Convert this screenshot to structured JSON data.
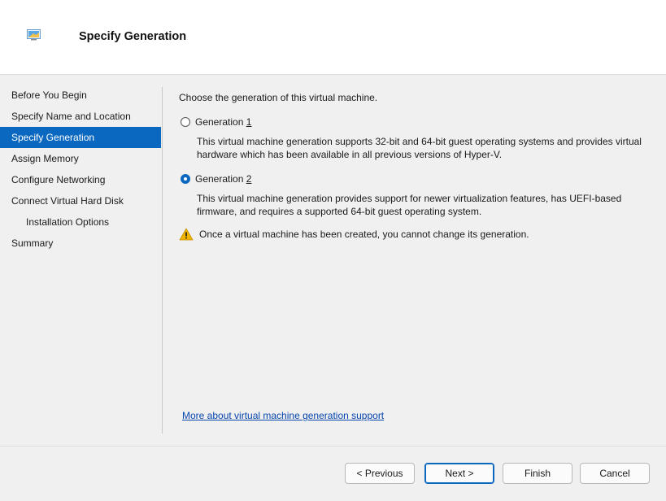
{
  "header": {
    "title": "Specify Generation",
    "icon": "virtual-machine-icon"
  },
  "sidebar": {
    "items": [
      {
        "label": "Before You Begin"
      },
      {
        "label": "Specify Name and Location"
      },
      {
        "label": "Specify Generation",
        "selected": true
      },
      {
        "label": "Assign Memory"
      },
      {
        "label": "Configure Networking"
      },
      {
        "label": "Connect Virtual Hard Disk"
      },
      {
        "label": "Installation Options",
        "sub": true
      },
      {
        "label": "Summary"
      }
    ]
  },
  "main": {
    "intro": "Choose the generation of this virtual machine.",
    "gen1": {
      "label_prefix": "Generation ",
      "label_key": "1",
      "checked": false,
      "description": "This virtual machine generation supports 32-bit and 64-bit guest operating systems and provides virtual hardware which has been available in all previous versions of Hyper-V."
    },
    "gen2": {
      "label_prefix": "Generation ",
      "label_key": "2",
      "checked": true,
      "description": "This virtual machine generation provides support for newer virtualization features, has UEFI-based firmware, and requires a supported 64-bit guest operating system."
    },
    "warning": "Once a virtual machine has been created, you cannot change its generation.",
    "link": "More about virtual machine generation support"
  },
  "footer": {
    "previous": "< Previous",
    "next": "Next >",
    "finish": "Finish",
    "cancel": "Cancel"
  },
  "colors": {
    "accent": "#0a68c1",
    "warning": "#f0b400",
    "link": "#0645ad"
  }
}
